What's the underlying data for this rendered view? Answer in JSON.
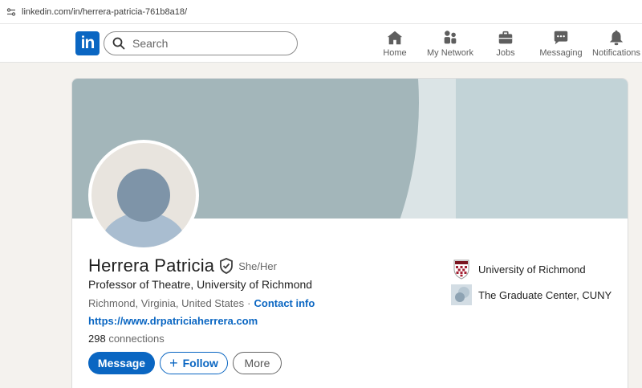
{
  "browser": {
    "url": "linkedin.com/in/herrera-patricia-761b8a18/"
  },
  "nav": {
    "logo": "in",
    "search_placeholder": "Search",
    "items": [
      {
        "label": "Home",
        "icon": "home-icon"
      },
      {
        "label": "My Network",
        "icon": "my-network-icon"
      },
      {
        "label": "Jobs",
        "icon": "jobs-icon"
      },
      {
        "label": "Messaging",
        "icon": "messaging-icon"
      },
      {
        "label": "Notifications",
        "icon": "notifications-icon"
      }
    ]
  },
  "profile": {
    "name": "Herrera Patricia",
    "pronouns": "She/Her",
    "headline": "Professor of Theatre, University of Richmond",
    "location": "Richmond, Virginia, United States",
    "separator": "·",
    "contact_info": "Contact info",
    "website": "https://www.drpatriciaherrera.com",
    "connections_count": "298",
    "connections_label": "connections",
    "buttons": {
      "message": "Message",
      "follow": "Follow",
      "more": "More"
    },
    "education": [
      {
        "name": "University of Richmond"
      },
      {
        "name": "The Graduate Center, CUNY"
      }
    ]
  },
  "colors": {
    "brand": "#0a66c2",
    "banner": "#a3b6ba"
  }
}
